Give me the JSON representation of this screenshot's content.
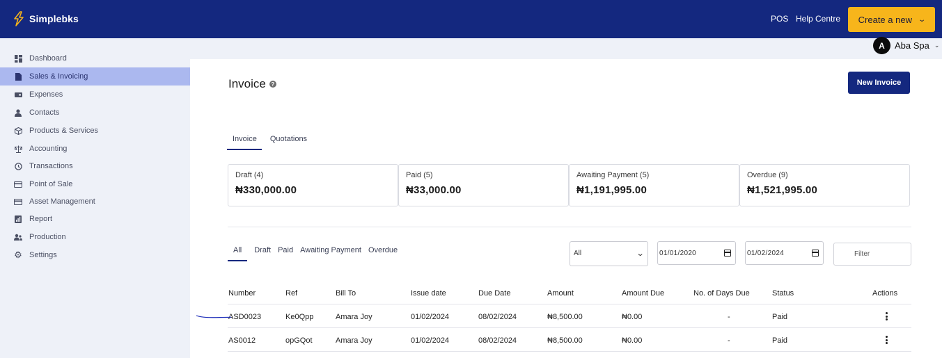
{
  "header": {
    "brand": "Simplebks",
    "links": [
      "POS",
      "Help Centre"
    ],
    "create_label": "Create a new",
    "user_initial": "A",
    "user_name": "Aba Spa"
  },
  "sidebar": {
    "items": [
      {
        "label": "Dashboard",
        "icon": "dashboard-icon"
      },
      {
        "label": "Sales & Invoicing",
        "icon": "document-icon",
        "active": true
      },
      {
        "label": "Expenses",
        "icon": "wallet-icon"
      },
      {
        "label": "Contacts",
        "icon": "person-icon"
      },
      {
        "label": "Products & Services",
        "icon": "box-icon"
      },
      {
        "label": "Accounting",
        "icon": "scale-icon"
      },
      {
        "label": "Transactions",
        "icon": "history-icon"
      },
      {
        "label": "Point of Sale",
        "icon": "card-icon"
      },
      {
        "label": "Asset Management",
        "icon": "card-icon"
      },
      {
        "label": "Report",
        "icon": "report-icon"
      },
      {
        "label": "Production",
        "icon": "people-icon"
      },
      {
        "label": "Settings",
        "icon": "gear-icon"
      }
    ]
  },
  "page": {
    "title": "Invoice",
    "new_invoice_label": "New Invoice",
    "tabs": [
      "Invoice",
      "Quotations"
    ],
    "cards": [
      {
        "label": "Draft (4)",
        "value": "₦330,000.00"
      },
      {
        "label": "Paid (5)",
        "value": "₦33,000.00"
      },
      {
        "label": "Awaiting Payment (5)",
        "value": "₦1,191,995.00"
      },
      {
        "label": "Overdue (9)",
        "value": "₦1,521,995.00"
      }
    ],
    "status_filters": [
      "All",
      "Draft",
      "Paid",
      "Awaiting Payment",
      "Overdue"
    ],
    "select_value": "All",
    "date_from": "01/01/2020",
    "date_to": "01/02/2024",
    "filter_placeholder": "Filter"
  },
  "table": {
    "columns": [
      "Number",
      "Ref",
      "Bill To",
      "Issue date",
      "Due Date",
      "Amount",
      "Amount Due",
      "No. of Days Due",
      "Status",
      "Actions"
    ],
    "rows": [
      [
        "ASD0023",
        "Ke0Qpp",
        "Amara Joy",
        "01/02/2024",
        "08/02/2024",
        "₦8,500.00",
        "₦0.00",
        "-",
        "Paid"
      ],
      [
        "AS0012",
        "opGQot",
        "Amara Joy",
        "01/02/2024",
        "08/02/2024",
        "₦8,500.00",
        "₦0.00",
        "-",
        "Paid"
      ]
    ]
  },
  "colors": {
    "brand_navy": "#14287f",
    "accent_yellow": "#f7b51b",
    "sidebar_active": "#abb8ef"
  }
}
